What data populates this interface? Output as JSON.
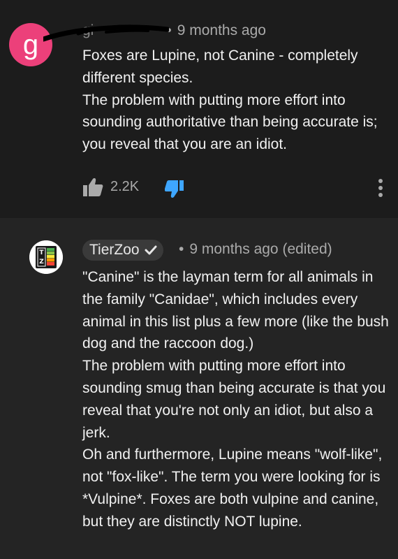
{
  "comments": [
    {
      "avatar_letter": "g",
      "author_redacted": "gi",
      "time": "9 months ago",
      "paragraphs": [
        "Foxes are Lupine, not Canine - completely different species.",
        "The problem with putting more effort into sounding authoritative than being accurate is; you reveal that you are an idiot."
      ],
      "like_count": "2.2K",
      "colors": {
        "avatar": "#ec407a",
        "dislike": "#3ea6ff"
      }
    },
    {
      "author": "TierZoo",
      "time": "9 months ago (edited)",
      "paragraphs": [
        "\"Canine\" is the layman term for all animals in the family \"Canidae\", which includes every animal in this list plus a few more (like the bush dog and the raccoon dog.)",
        "The problem with putting more effort into sounding smug than being accurate is that you reveal that you're not only an idiot, but also a jerk.",
        "Oh and furthermore, Lupine means \"wolf-like\", not \"fox-like\". The term you were looking for is *Vulpine*. Foxes are both vulpine and canine, but they are distinctly NOT lupine."
      ]
    }
  ],
  "separator": "•",
  "icons": [
    "thumbs-up-icon",
    "thumbs-down-icon",
    "more-vert-icon",
    "verified-check-icon"
  ]
}
